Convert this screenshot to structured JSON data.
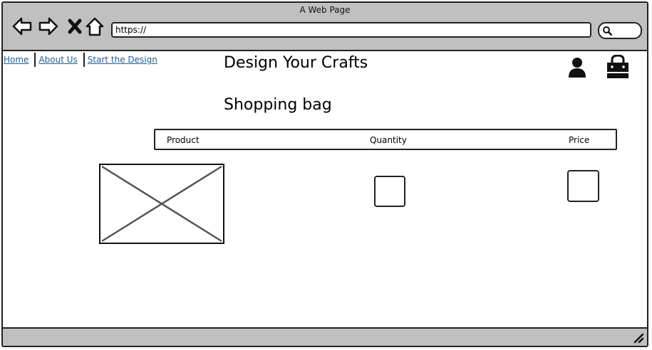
{
  "window": {
    "title": "A Web Page"
  },
  "address_bar": {
    "url": "https://"
  },
  "nav": {
    "home": "Home",
    "about": "About Us",
    "start": "Start the Design"
  },
  "header": {
    "brand": "Design Your Crafts"
  },
  "page": {
    "title": "Shopping bag"
  },
  "table": {
    "col_product": "Product",
    "col_quantity": "Quantity",
    "col_price": "Price"
  },
  "icons": {
    "back": "back-arrow-icon",
    "forward": "forward-arrow-icon",
    "stop": "close-icon",
    "home": "home-icon",
    "search": "search-icon",
    "user": "user-icon",
    "bag": "shopping-bag-icon"
  },
  "colors": {
    "link": "#1f5f99",
    "chrome": "#c0c0c0"
  }
}
